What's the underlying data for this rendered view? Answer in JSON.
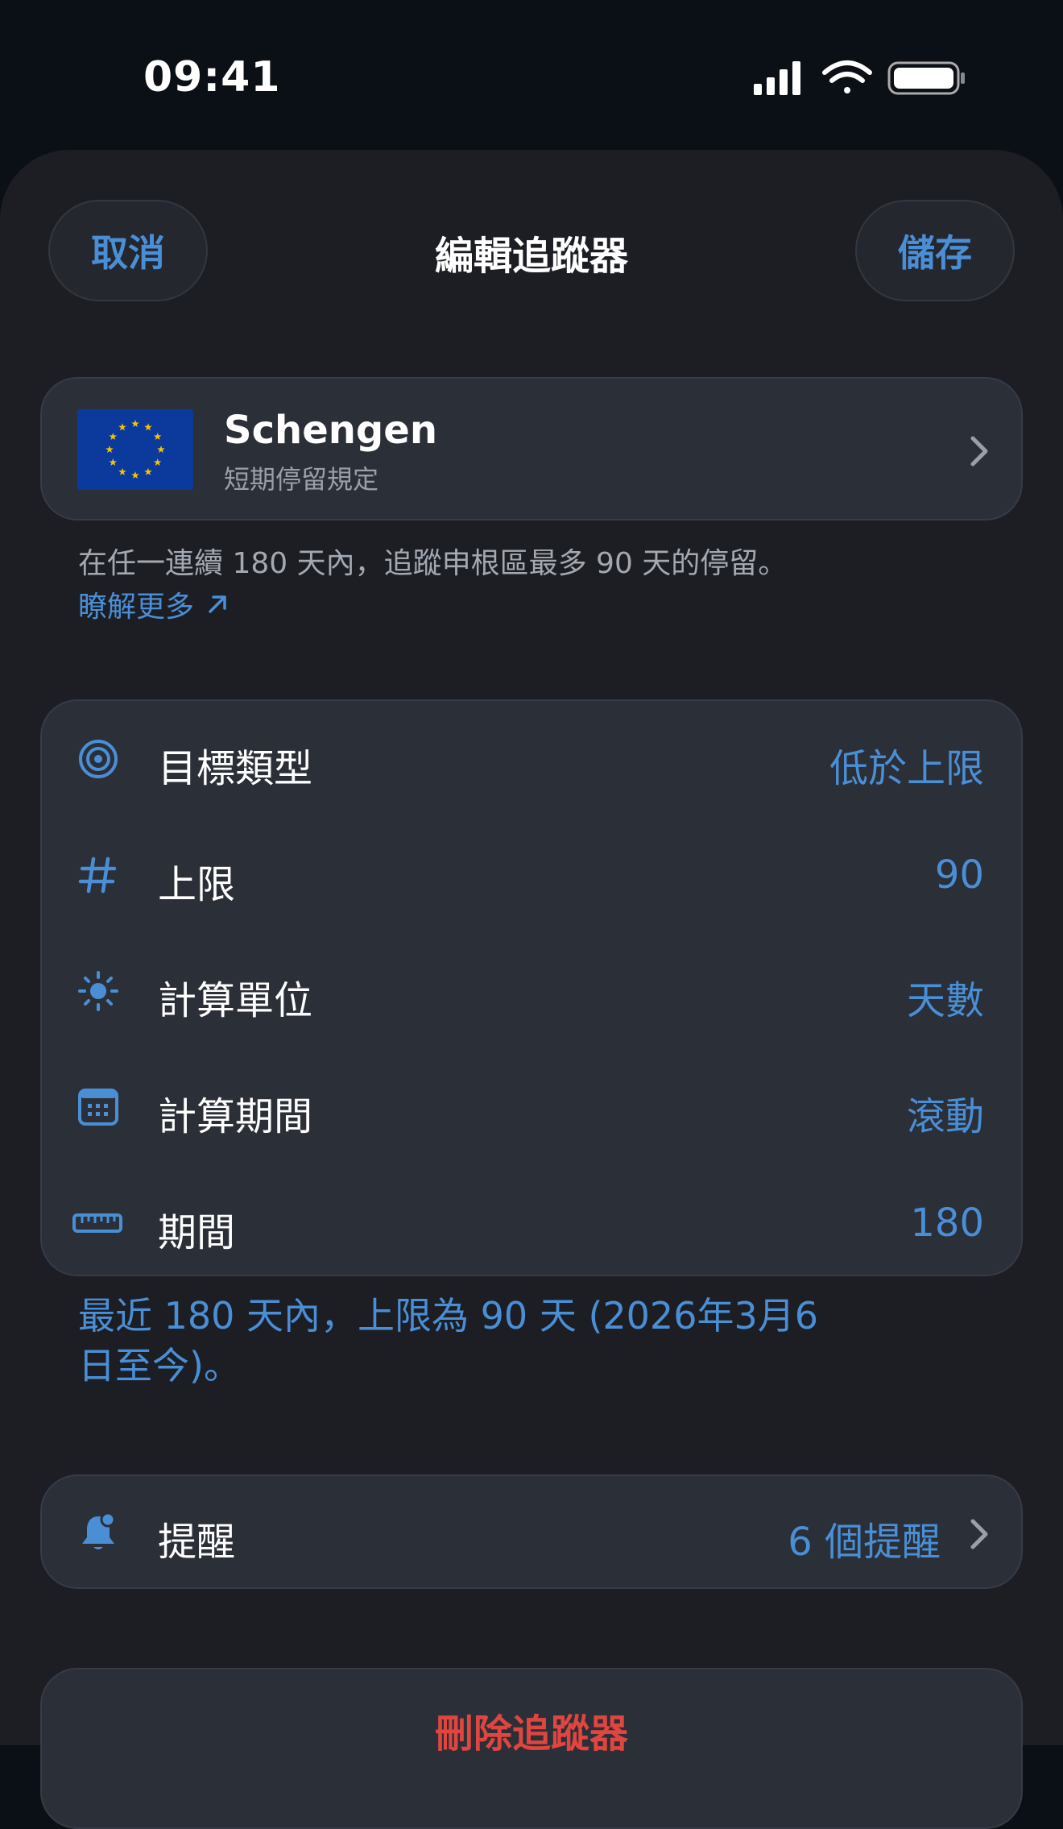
{
  "status_bar": {
    "time": "09:41"
  },
  "nav": {
    "cancel": "取消",
    "title": "編輯追蹤器",
    "save": "儲存"
  },
  "rule": {
    "name": "Schengen",
    "subtitle": "短期停留規定",
    "flag_icon": "eu-flag-icon"
  },
  "description": "在任一連續 180 天內，追蹤申根區最多 90 天的停留。",
  "learn_more": "瞭解更多",
  "settings": [
    {
      "icon": "target-icon",
      "label": "目標類型",
      "value": "低於上限"
    },
    {
      "icon": "hash-icon",
      "label": "上限",
      "value": "90"
    },
    {
      "icon": "sun-icon",
      "label": "計算單位",
      "value": "天數"
    },
    {
      "icon": "calendar-icon",
      "label": "計算期間",
      "value": "滾動"
    },
    {
      "icon": "ruler-icon",
      "label": "期間",
      "value": "180"
    }
  ],
  "summary": "最近 180 天內，上限為 90 天 (2026年3月6日至今)。",
  "reminders": {
    "icon": "bell-icon",
    "label": "提醒",
    "value": "6 個提醒"
  },
  "delete_label": "刪除追蹤器",
  "colors": {
    "accent": "#4a8fd6",
    "destructive": "#e0453f",
    "card": "#2b2f38",
    "sheet": "#1c1e24"
  }
}
